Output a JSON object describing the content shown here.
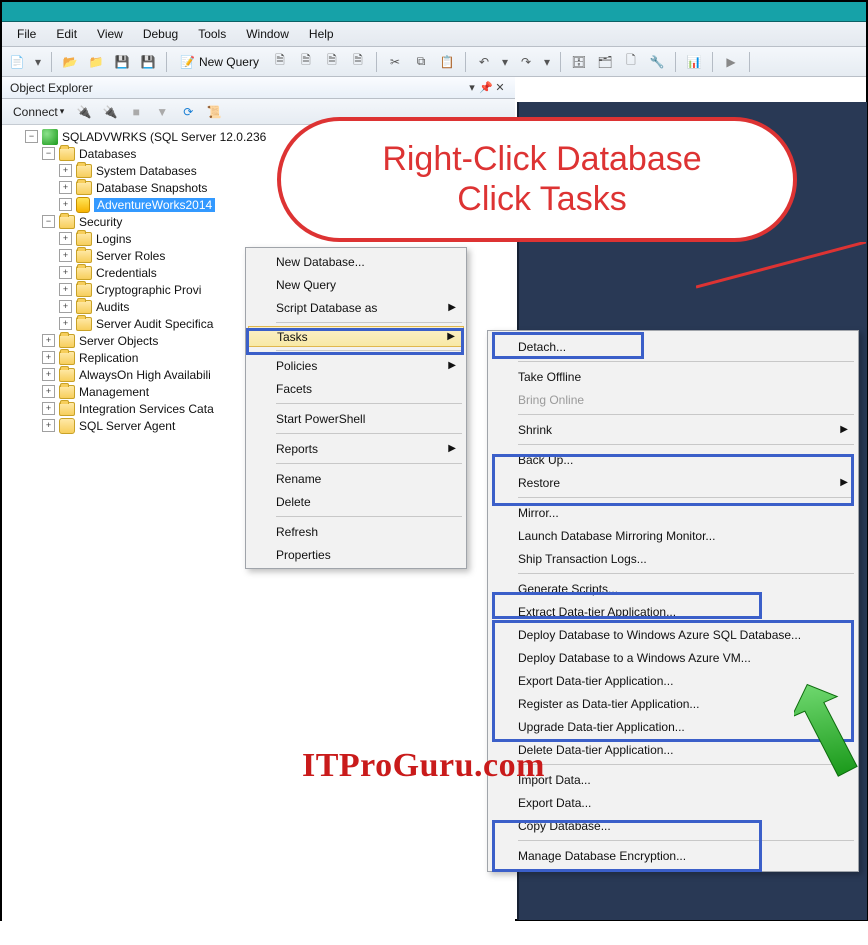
{
  "menubar": [
    "File",
    "Edit",
    "View",
    "Debug",
    "Tools",
    "Window",
    "Help"
  ],
  "toolbar": {
    "new_query": "New Query"
  },
  "panel": {
    "title": "Object Explorer",
    "connect": "Connect"
  },
  "tree": {
    "server": "SQLADVWRKS (SQL Server 12.0.236",
    "databases": "Databases",
    "sysdb": "System Databases",
    "snap": "Database Snapshots",
    "aw": "AdventureWorks2014",
    "security": "Security",
    "logins": "Logins",
    "server_roles": "Server Roles",
    "credentials": "Credentials",
    "crypto": "Cryptographic Provi",
    "audits": "Audits",
    "server_audit": "Server Audit Specifica",
    "server_objects": "Server Objects",
    "replication": "Replication",
    "alwayson": "AlwaysOn High Availabili",
    "management": "Management",
    "isc": "Integration Services Cata",
    "agent": "SQL Server Agent"
  },
  "ctx1": {
    "new_db": "New Database...",
    "new_query": "New Query",
    "script": "Script Database as",
    "tasks": "Tasks",
    "policies": "Policies",
    "facets": "Facets",
    "ps": "Start PowerShell",
    "reports": "Reports",
    "rename": "Rename",
    "delete": "Delete",
    "refresh": "Refresh",
    "props": "Properties"
  },
  "ctx2": {
    "detach": "Detach...",
    "offline": "Take Offline",
    "online": "Bring Online",
    "shrink": "Shrink",
    "backup": "Back Up...",
    "restore": "Restore",
    "mirror": "Mirror...",
    "launch_mirror": "Launch Database Mirroring Monitor...",
    "ship": "Ship Transaction Logs...",
    "gen_scripts": "Generate Scripts...",
    "extract": "Extract Data-tier Application...",
    "deploy_sql": "Deploy Database to Windows Azure SQL Database...",
    "deploy_vm": "Deploy Database to a Windows Azure VM...",
    "export_dta": "Export Data-tier Application...",
    "register": "Register as Data-tier Application...",
    "upgrade": "Upgrade Data-tier Application...",
    "delete_dta": "Delete Data-tier Application...",
    "import": "Import Data...",
    "export": "Export Data...",
    "copy": "Copy Database...",
    "encrypt": "Manage Database Encryption..."
  },
  "callout": {
    "line1": "Right-Click Database",
    "line2": "Click Tasks"
  },
  "watermark": "ITProGuru.com"
}
